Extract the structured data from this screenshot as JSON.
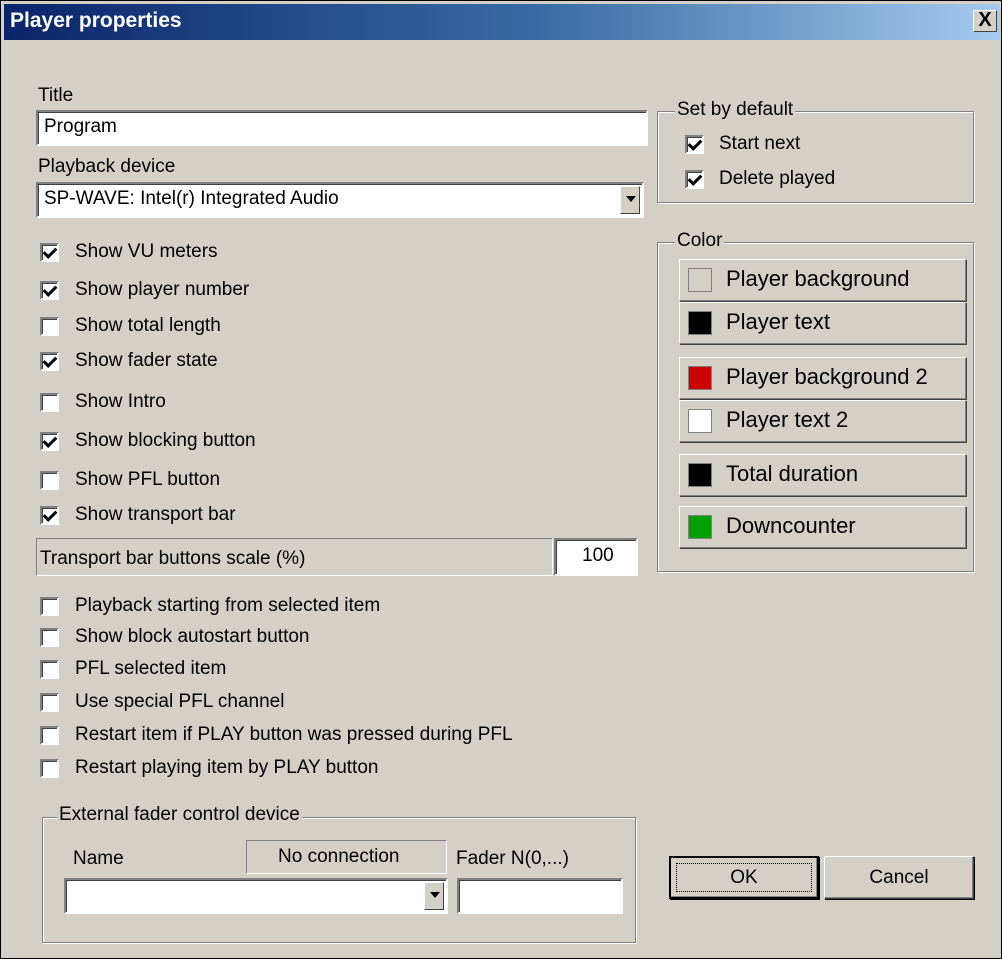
{
  "window": {
    "title": "Player properties",
    "close_glyph": "X"
  },
  "title_field": {
    "label": "Title",
    "value": "Program"
  },
  "playback_device": {
    "label": "Playback device",
    "value": "SP-WAVE: Intel(r) Integrated Audio"
  },
  "options_top": [
    {
      "label": "Show VU meters",
      "checked": true
    },
    {
      "label": "Show player number",
      "checked": true
    },
    {
      "label": "Show total length",
      "checked": false
    },
    {
      "label": "Show fader state",
      "checked": true
    },
    {
      "label": "Show Intro",
      "checked": false
    },
    {
      "label": "Show blocking button",
      "checked": true
    },
    {
      "label": "Show PFL button",
      "checked": false
    },
    {
      "label": "Show transport bar",
      "checked": true
    }
  ],
  "transport_scale": {
    "label": "Transport bar buttons scale (%)",
    "value": "100"
  },
  "options_bottom": [
    {
      "label": "Playback starting from selected item",
      "checked": false
    },
    {
      "label": "Show block autostart button",
      "checked": false
    },
    {
      "label": "PFL selected item",
      "checked": false
    },
    {
      "label": "Use special PFL channel",
      "checked": false
    },
    {
      "label": "Restart item if PLAY button was pressed during PFL",
      "checked": false
    },
    {
      "label": "Restart playing item by PLAY button",
      "checked": false
    }
  ],
  "set_by_default": {
    "legend": "Set by default",
    "items": [
      {
        "label": "Start next",
        "checked": true
      },
      {
        "label": "Delete played",
        "checked": true
      }
    ]
  },
  "color": {
    "legend": "Color",
    "items": [
      {
        "label": "Player background",
        "color": "#d4d0c8"
      },
      {
        "label": "Player text",
        "color": "#000000"
      },
      {
        "label": "Player background 2",
        "color": "#cc0000"
      },
      {
        "label": "Player text 2",
        "color": "#ffffff"
      },
      {
        "label": "Total duration",
        "color": "#000000"
      },
      {
        "label": "Downcounter",
        "color": "#00a000"
      }
    ]
  },
  "external_fader": {
    "legend": "External fader control device",
    "name_label": "Name",
    "name_value": "",
    "status": "No connection",
    "fader_label": "Fader N(0,...)",
    "fader_value": ""
  },
  "buttons": {
    "ok": "OK",
    "cancel": "Cancel"
  }
}
